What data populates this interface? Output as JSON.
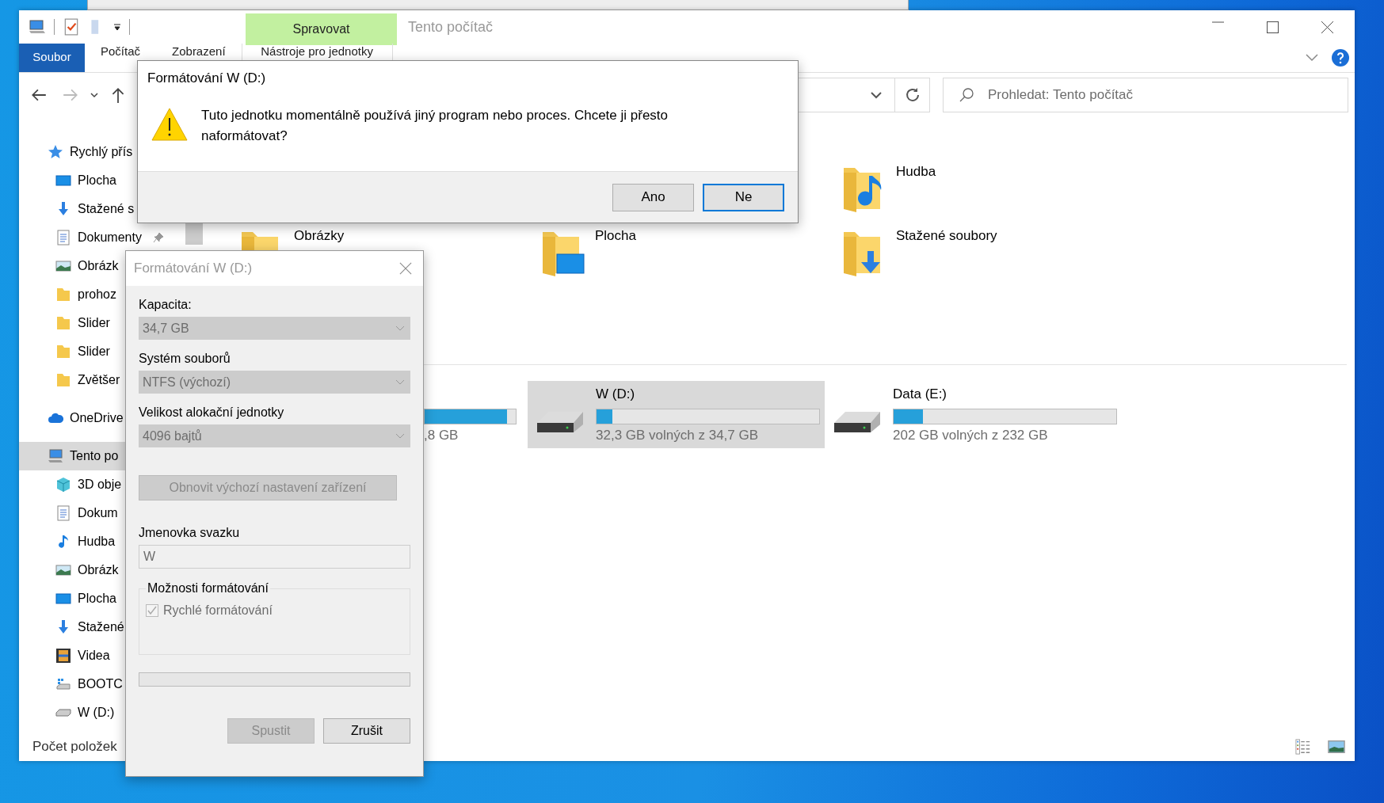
{
  "explorer": {
    "title": "Tento počítač",
    "context_tab": "Spravovat",
    "ribbon_tabs": [
      {
        "label": "Soubor",
        "selected": true
      },
      {
        "label": "Počítač",
        "selected": false
      },
      {
        "label": "Zobrazení",
        "selected": false
      },
      {
        "label": "Nástroje pro jednotky",
        "selected": false
      }
    ],
    "search": {
      "placeholder": "Prohledat: Tento počítač"
    },
    "sidebar": {
      "items": [
        {
          "label": "Rychlý přís",
          "kind": "star",
          "selected": false,
          "children": [
            {
              "label": "Plocha",
              "kind": "desktop",
              "selected": false
            },
            {
              "label": "Stažené s",
              "kind": "download",
              "selected": false
            },
            {
              "label": "Dokumenty",
              "kind": "document",
              "selected": false,
              "pinned": true
            },
            {
              "label": "Obrázk",
              "kind": "pictures",
              "selected": false
            },
            {
              "label": "prohoz",
              "kind": "folder",
              "selected": false
            },
            {
              "label": "Slider",
              "kind": "folder",
              "selected": false
            },
            {
              "label": "Slider",
              "kind": "folder",
              "selected": false
            },
            {
              "label": "Zvětšer",
              "kind": "folder",
              "selected": false
            }
          ]
        },
        {
          "label": "OneDrive",
          "kind": "cloud",
          "selected": false
        },
        {
          "label": "Tento po",
          "kind": "computer",
          "selected": true,
          "children": [
            {
              "label": "3D obje",
              "kind": "cube",
              "selected": false
            },
            {
              "label": "Dokum",
              "kind": "document",
              "selected": false
            },
            {
              "label": "Hudba",
              "kind": "music",
              "selected": false
            },
            {
              "label": "Obrázk",
              "kind": "pictures",
              "selected": false
            },
            {
              "label": "Plocha",
              "kind": "desktop",
              "selected": false
            },
            {
              "label": "Stažené",
              "kind": "download",
              "selected": false
            },
            {
              "label": "Videa",
              "kind": "video",
              "selected": false
            },
            {
              "label": "BOOTC",
              "kind": "bootcamp",
              "selected": false
            },
            {
              "label": "W (D:)",
              "kind": "drive",
              "selected": false
            }
          ]
        }
      ]
    },
    "folder_rows": [
      [
        {
          "name": "Hudba",
          "kind": "music"
        }
      ],
      [
        {
          "name": "Obrázky",
          "kind": "pictures"
        },
        {
          "name": "Plocha",
          "kind": "desktop"
        },
        {
          "name": "Stažené soubory",
          "kind": "download"
        }
      ]
    ],
    "drives": [
      {
        "free": ",8 GB",
        "level": 0.9,
        "selected": false,
        "partial": true
      },
      {
        "name": "W (D:)",
        "free": "32,3 GB volných z 34,7 GB",
        "level": 0.07,
        "selected": true
      },
      {
        "name": "Data (E:)",
        "free": "202 GB volných z 232 GB",
        "level": 0.13,
        "selected": false
      }
    ],
    "status_bar": "Počet položek"
  },
  "confirm_dialog": {
    "title": "Formátování W (D:)",
    "message": "Tuto jednotku momentálně používá jiný program nebo proces. Chcete ji přesto naformátovat?",
    "buttons": [
      {
        "label": "Ano",
        "focused": false
      },
      {
        "label": "Ne",
        "focused": true
      }
    ]
  },
  "format_dialog": {
    "title": "Formátování W (D:)",
    "fields": [
      {
        "label": "Kapacita:",
        "value": "34,7 GB",
        "disabled": true
      },
      {
        "label": "Systém souborů",
        "value": "NTFS (výchozí)",
        "disabled": true
      },
      {
        "label": "Velikost alokační jednotky",
        "value": "4096 bajtů",
        "disabled": true
      }
    ],
    "restore_button": "Obnovit výchozí nastavení zařízení",
    "volume_label": {
      "label": "Jmenovka svazku",
      "value": "W"
    },
    "options": {
      "title": "Možnosti formátování",
      "checkboxes": [
        {
          "label": "Rychlé formátování",
          "checked": true,
          "disabled": true
        }
      ]
    },
    "progress": {
      "level": 0
    },
    "buttons": [
      {
        "label": "Spustit",
        "disabled": true
      },
      {
        "label": "Zrušit",
        "disabled": false
      }
    ]
  }
}
